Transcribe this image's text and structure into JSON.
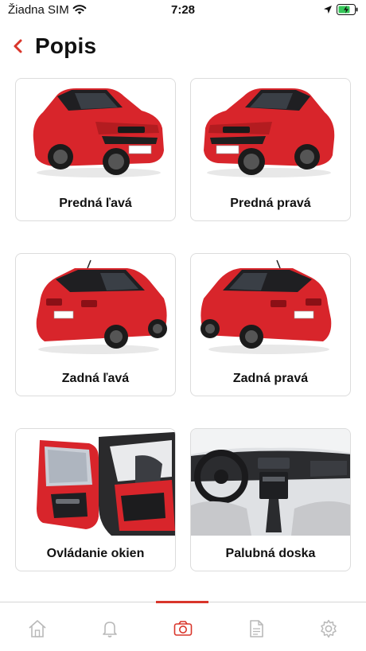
{
  "status_bar": {
    "carrier": "Žiadna SIM",
    "time": "7:28"
  },
  "header": {
    "title": "Popis"
  },
  "cards": [
    {
      "label": "Predná ľavá",
      "icon": "car-front-left"
    },
    {
      "label": "Predná pravá",
      "icon": "car-front-right"
    },
    {
      "label": "Zadná ľavá",
      "icon": "car-rear-left"
    },
    {
      "label": "Zadná pravá",
      "icon": "car-rear-right"
    },
    {
      "label": "Ovládanie okien",
      "icon": "car-door-open"
    },
    {
      "label": "Palubná doska",
      "icon": "car-dashboard"
    }
  ],
  "tabbar": {
    "tabs": [
      "home-icon",
      "bell-icon",
      "camera-icon",
      "document-icon",
      "gear-icon"
    ],
    "active_tab": "camera-icon"
  },
  "colors": {
    "accent": "#d9362b",
    "car_red": "#d8252b",
    "tab_inactive": "#b9b9b9"
  }
}
